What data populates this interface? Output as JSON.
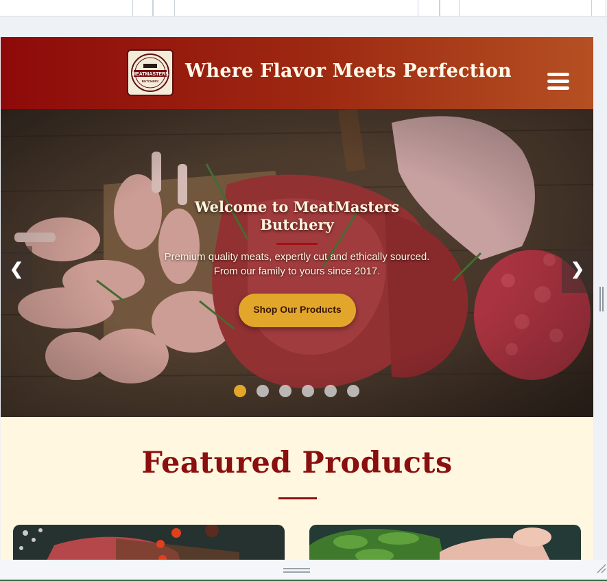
{
  "header": {
    "tagline": "Where Flavor Meets Perfection",
    "logo_text": "MEATMASTERS",
    "logo_subtext": "BUTCHERY",
    "menu_icon": "hamburger-menu-icon"
  },
  "hero": {
    "title": "Welcome to MeatMasters Butchery",
    "subtitle": "Premium quality meats, expertly cut and ethically sourced. From our family to yours since 2017.",
    "cta_label": "Shop Our Products",
    "prev_label": "❮",
    "next_label": "❯",
    "slide_count": 6,
    "active_slide": 1
  },
  "featured": {
    "title": "Featured Products"
  },
  "colors": {
    "brand_red": "#8a0f0f",
    "accent_gold": "#e2a72a",
    "cream": "#fff7e0"
  }
}
